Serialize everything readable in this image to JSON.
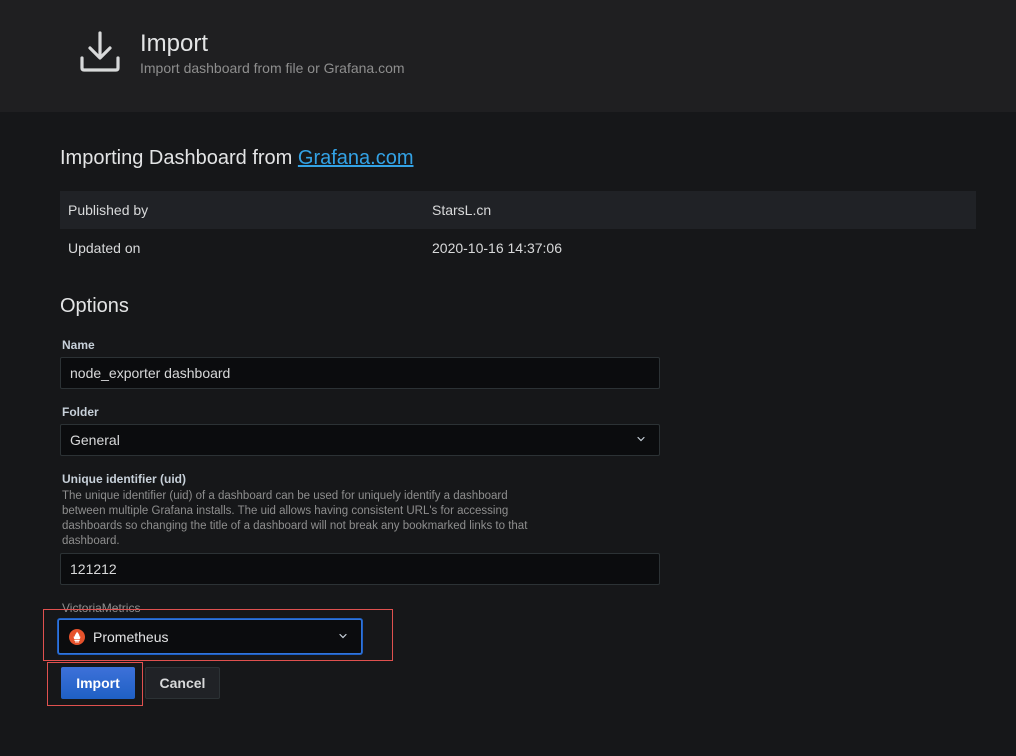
{
  "header": {
    "title": "Import",
    "subtitle": "Import dashboard from file or Grafana.com"
  },
  "importing": {
    "prefix": "Importing Dashboard from ",
    "link": "Grafana.com"
  },
  "info": [
    {
      "label": "Published by",
      "value": "StarsL.cn"
    },
    {
      "label": "Updated on",
      "value": "2020-10-16 14:37:06"
    }
  ],
  "options": {
    "heading": "Options",
    "name_label": "Name",
    "name_value": "node_exporter dashboard",
    "folder_label": "Folder",
    "folder_value": "General",
    "uid_label": "Unique identifier (uid)",
    "uid_description": "The unique identifier (uid) of a dashboard can be used for uniquely identify a dashboard between multiple Grafana installs. The uid allows having consistent URL's for accessing dashboards so changing the title of a dashboard will not break any bookmarked links to that dashboard.",
    "uid_value": "121212",
    "datasource_label": "VictoriaMetrics",
    "datasource_value": "Prometheus"
  },
  "buttons": {
    "import": "Import",
    "cancel": "Cancel"
  },
  "colors": {
    "link": "#33a2e5",
    "primary": "#1f60c4",
    "highlight_box": "#e0514f",
    "prometheus": "#e6522c"
  },
  "icons": {
    "header": "download-icon",
    "select": "chevron-down-icon",
    "datasource": "prometheus-logo-icon"
  }
}
